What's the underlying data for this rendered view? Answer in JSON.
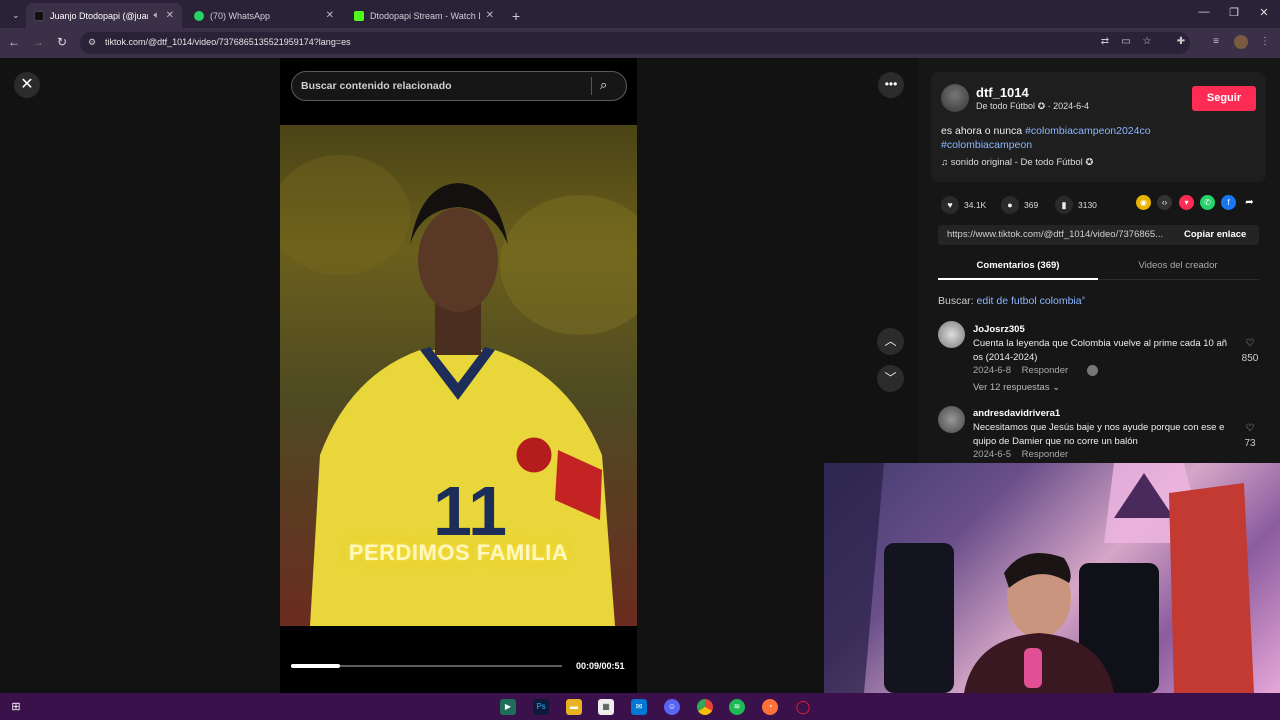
{
  "browser": {
    "tabs": [
      {
        "title": "Juanjo Dtodopapi (@juanjo",
        "active": true,
        "color": "#1a1a1a"
      },
      {
        "title": "(70) WhatsApp",
        "active": false,
        "color": "#25d366"
      },
      {
        "title": "Dtodopapi Stream - Watch Live",
        "active": false,
        "color": "#53fc18"
      }
    ],
    "new_tab": "+",
    "url": "tiktok.com/@dtf_1014/video/7376865135521959174?lang=es"
  },
  "player": {
    "search_placeholder": "Buscar contenido relacionado",
    "caption": "PERDIMOS FAMILIA",
    "progress": 0.18,
    "time": "00:09/00:51"
  },
  "post": {
    "username": "dtf_1014",
    "display_name": "De todo Fútbol",
    "date": "2024-6-4",
    "follow_label": "Seguir",
    "desc_text": "es ahora o nunca ",
    "tags": [
      "#colombiacampeon2024co",
      "#colombiacampeon"
    ],
    "sound": "sonido original - De todo Fútbol",
    "likes": "34.1K",
    "comments": "369",
    "saves": "3130",
    "link": "https://www.tiktok.com/@dtf_1014/video/7376865...",
    "copy_label": "Copiar enlace"
  },
  "panel_tabs": [
    "Comentarios (369)",
    "Videos del creador"
  ],
  "search_suggestion": {
    "prefix": "Buscar:",
    "query": "edit de futbol colombia"
  },
  "comments_list": [
    {
      "user": "JoJosrz305",
      "text": "Cuenta la leyenda que Colombia vuelve al prime cada 10 añ os (2014-2024)",
      "date": "2024-6-8",
      "reply": "Responder",
      "likes": "850",
      "view_replies": "Ver 12 respuestas"
    },
    {
      "user": "andresdavidrivera1",
      "text": "Necesitamos que Jesús baje y nos ayude porque con ese e quipo de Damier que no corre un balón",
      "date": "2024-6-5",
      "reply": "Responder",
      "likes": "73"
    }
  ],
  "colors": {
    "accent": "#fe2c55",
    "hashtag": "#8cb5ff",
    "taskbar": "#3a114b"
  }
}
